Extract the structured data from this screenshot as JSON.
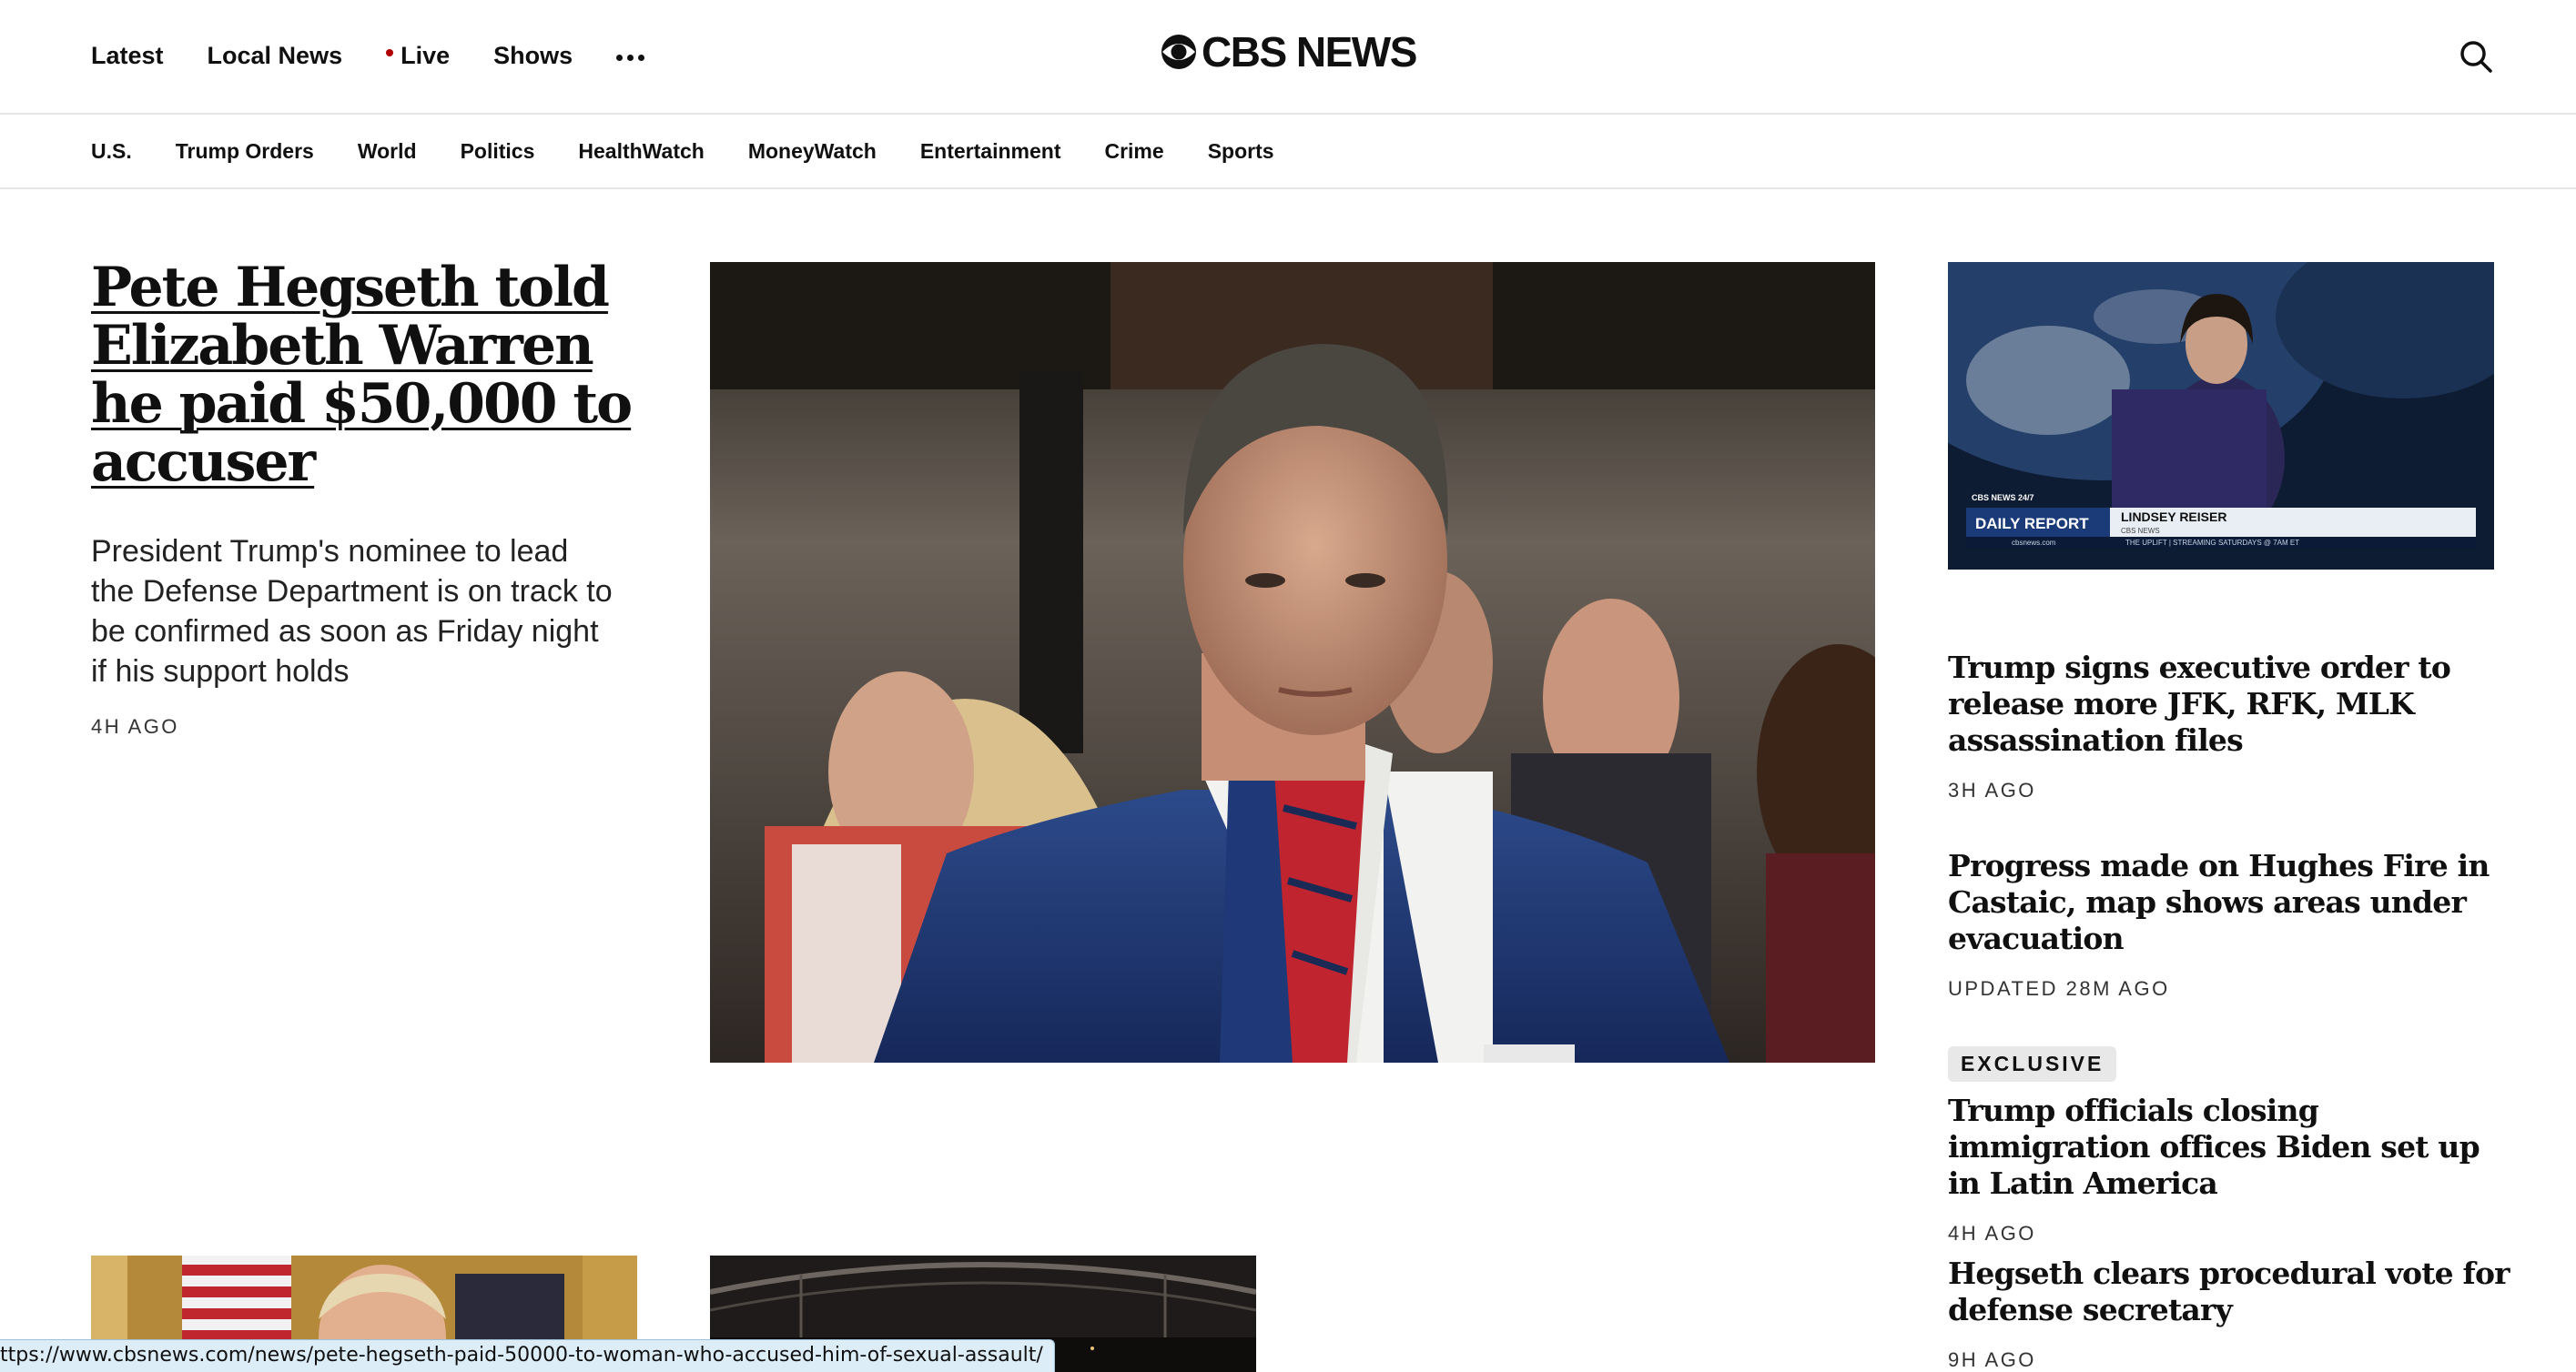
{
  "topnav": {
    "items": [
      {
        "label": "Latest"
      },
      {
        "label": "Local News"
      },
      {
        "label": "Live"
      },
      {
        "label": "Shows"
      }
    ],
    "more_icon": "ellipsis-icon",
    "live_dot_color": "#b00000"
  },
  "logo": {
    "text": "CBS NEWS",
    "icon": "cbs-eye-icon"
  },
  "search": {
    "icon": "search-icon"
  },
  "sections": [
    "U.S.",
    "Trump Orders",
    "World",
    "Politics",
    "HealthWatch",
    "MoneyWatch",
    "Entertainment",
    "Crime",
    "Sports"
  ],
  "lead": {
    "headline": "Pete Hegseth told Elizabeth Warren he paid $50,000 to accuser",
    "dek": "President Trump's nominee to lead the Defense Department is on track to be confirmed as soon as Friday night if his support holds",
    "time": "4H AGO"
  },
  "rail_video": {
    "network_tag": "CBS NEWS 24/7",
    "program": "DAILY REPORT",
    "anchor": "LINDSEY REISER",
    "anchor_sub": "CBS NEWS",
    "ticker": "THE UPLIFT | STREAMING SATURDAYS @ 7AM ET",
    "site": "cbsnews.com"
  },
  "rail": [
    {
      "headline": "Trump signs executive order to release more JFK, RFK, MLK assassination files",
      "time": "3H AGO",
      "badge": ""
    },
    {
      "headline": "Progress made on Hughes Fire in Castaic, map shows areas under evacuation",
      "time": "UPDATED 28M AGO",
      "badge": ""
    },
    {
      "headline": "Trump officials closing immigration offices Biden set up in Latin America",
      "time": "4H AGO",
      "badge": "EXCLUSIVE"
    },
    {
      "headline": "Hegseth clears procedural vote for defense secretary",
      "time": "9H AGO",
      "badge": ""
    }
  ],
  "statusbar": {
    "url": "ttps://www.cbsnews.com/news/pete-hegseth-paid-50000-to-woman-who-accused-him-of-sexual-assault/"
  }
}
